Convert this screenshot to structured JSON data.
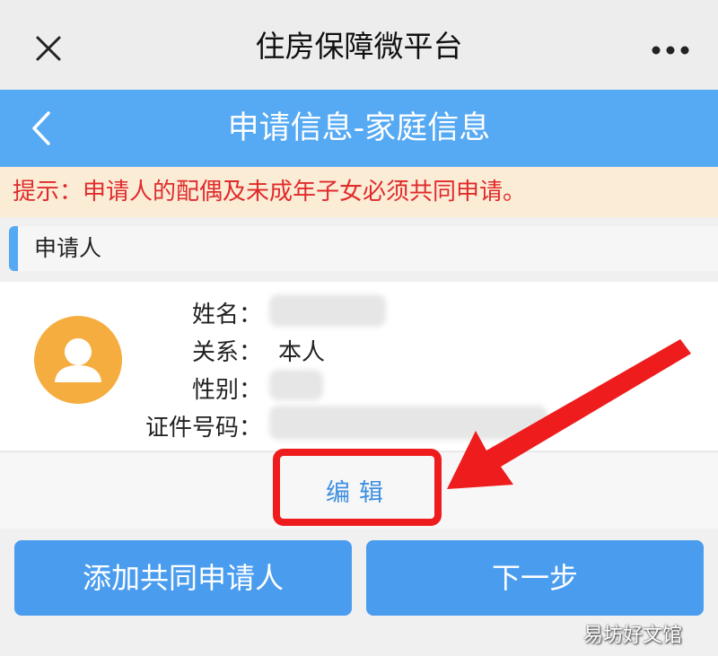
{
  "wechat_bar": {
    "title": "住房保障微平台",
    "close_icon": "close-icon",
    "more_icon": "more-icon"
  },
  "header": {
    "title": "申请信息-家庭信息",
    "back_icon": "back-chevron-icon"
  },
  "tip": {
    "text": "提示：申请人的配偶及未成年子女必须共同申请。"
  },
  "section": {
    "label": "申请人"
  },
  "applicant": {
    "avatar_icon": "user-avatar-icon",
    "fields": {
      "name": {
        "label": "姓名：",
        "value": ""
      },
      "relation": {
        "label": "关系：",
        "value": "本人"
      },
      "gender": {
        "label": "性别：",
        "value": ""
      },
      "id_number": {
        "label": "证件号码：",
        "value": ""
      }
    }
  },
  "edit": {
    "label": "编辑"
  },
  "buttons": {
    "add_co_applicant": "添加共同申请人",
    "next": "下一步"
  },
  "watermark": {
    "text": "易坊好文馆"
  },
  "colors": {
    "primary": "#56a9f3",
    "button": "#4a9cef",
    "tip_bg": "#fbecd6",
    "tip_text": "#e02b2b",
    "avatar": "#f5ad3f",
    "highlight": "#ee1c1c"
  }
}
